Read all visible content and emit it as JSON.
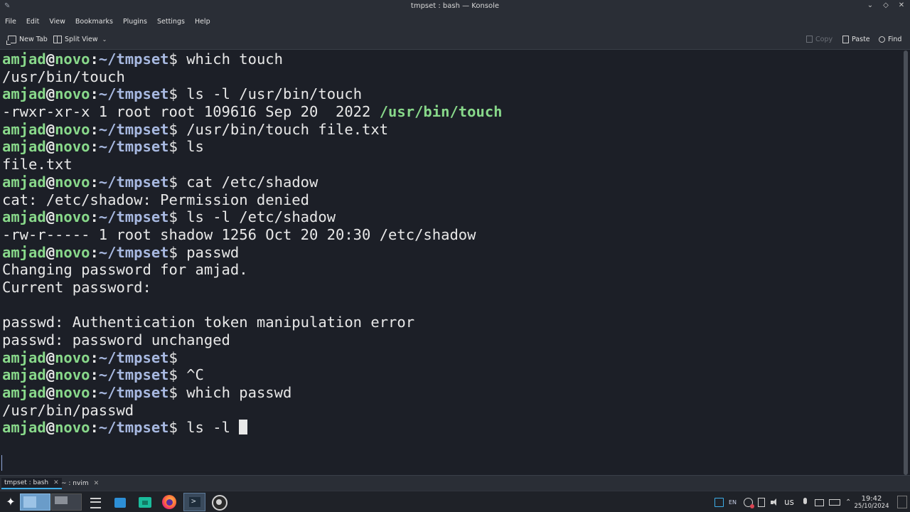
{
  "window": {
    "title": "tmpset : bash — Konsole"
  },
  "menu": [
    "File",
    "Edit",
    "View",
    "Bookmarks",
    "Plugins",
    "Settings",
    "Help"
  ],
  "toolbar": {
    "new_tab": "New Tab",
    "split_view": "Split View",
    "copy": "Copy",
    "paste": "Paste",
    "find": "Find"
  },
  "terminal": {
    "prompt_user": "amjad",
    "prompt_at": "@",
    "prompt_host": "novo",
    "prompt_colon": ":",
    "prompt_path": "~/tmpset",
    "prompt_dollar": "$",
    "lines": [
      {
        "type": "cmd",
        "text": " which touch"
      },
      {
        "type": "out",
        "text": "/usr/bin/touch"
      },
      {
        "type": "cmd",
        "text": " ls -l /usr/bin/touch"
      },
      {
        "type": "out",
        "text": "-rwxr-xr-x 1 root root 109616 Sep 20  2022 ",
        "highlight": "/usr/bin/touch"
      },
      {
        "type": "cmd",
        "text": " /usr/bin/touch file.txt"
      },
      {
        "type": "cmd",
        "text": " ls"
      },
      {
        "type": "out",
        "text": "file.txt"
      },
      {
        "type": "cmd",
        "text": " cat /etc/shadow"
      },
      {
        "type": "out",
        "text": "cat: /etc/shadow: Permission denied"
      },
      {
        "type": "cmd",
        "text": " ls -l /etc/shadow"
      },
      {
        "type": "out",
        "text": "-rw-r----- 1 root shadow 1256 Oct 20 20:30 /etc/shadow"
      },
      {
        "type": "cmd",
        "text": " passwd"
      },
      {
        "type": "out",
        "text": "Changing password for amjad."
      },
      {
        "type": "out",
        "text": "Current password:"
      },
      {
        "type": "out",
        "text": ""
      },
      {
        "type": "out",
        "text": "passwd: Authentication token manipulation error"
      },
      {
        "type": "out",
        "text": "passwd: password unchanged"
      },
      {
        "type": "cmd",
        "text": ""
      },
      {
        "type": "cmd",
        "text": " ^C"
      },
      {
        "type": "cmd",
        "text": " which passwd"
      },
      {
        "type": "out",
        "text": "/usr/bin/passwd"
      },
      {
        "type": "cmd",
        "text": " ls -l ",
        "cursor": true
      }
    ]
  },
  "session_tabs": [
    {
      "label": "tmpset : bash",
      "active": true
    },
    {
      "label": "~ : nvim",
      "active": false
    }
  ],
  "taskbar": {
    "tray_lang": "EN",
    "keyboard_layout": "us",
    "time": "19:42",
    "date": "25/10/2024"
  },
  "colors": {
    "terminal_bg": "#1c1f27",
    "prompt_user_host": "#88d88a",
    "prompt_path": "#a7b8e0",
    "accent": "#3daee9"
  }
}
